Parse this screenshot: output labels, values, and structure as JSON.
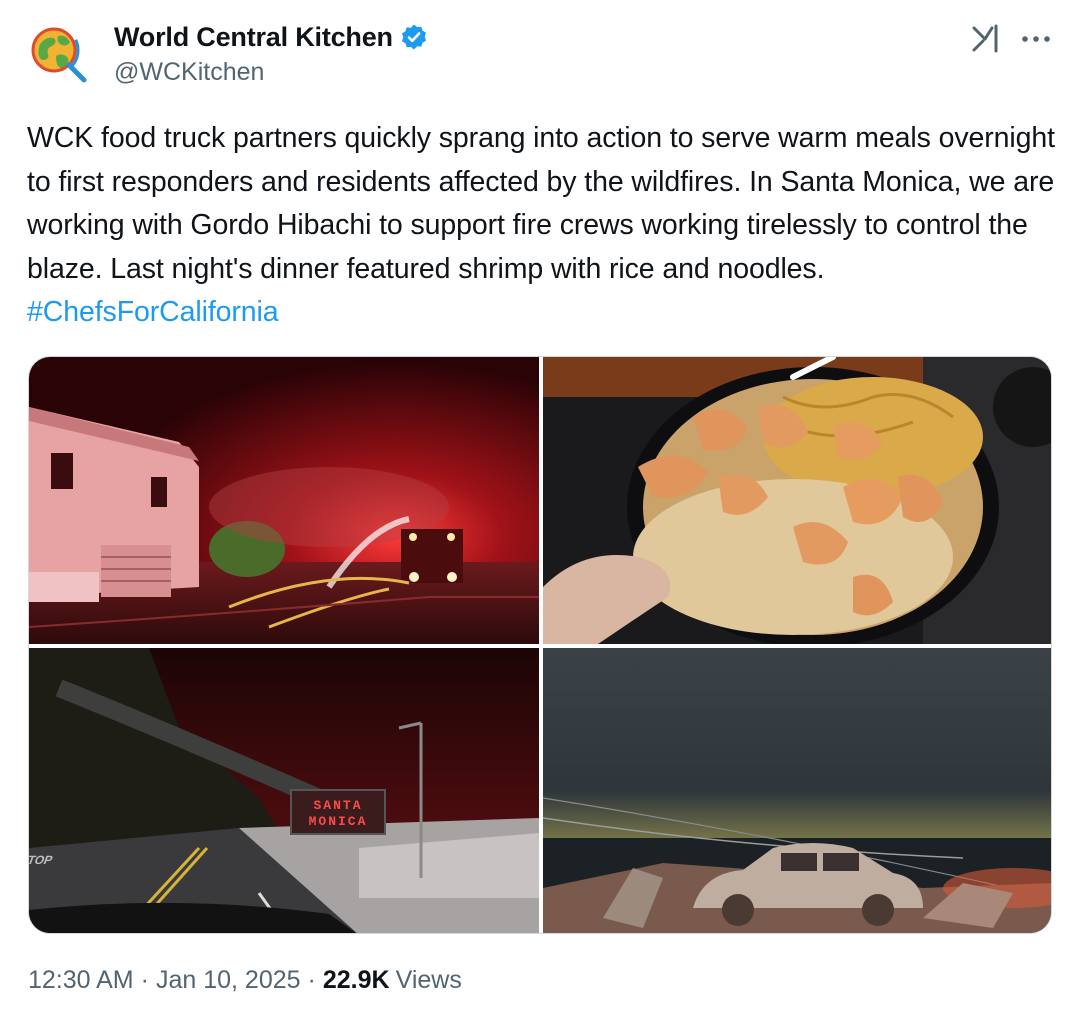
{
  "author": {
    "display_name": "World Central Kitchen",
    "handle": "@WCKitchen",
    "verified": true,
    "avatar_icon": "wck-globe-logo-icon"
  },
  "actions": {
    "grok_icon": "grok-icon",
    "more_icon": "more-dots-icon"
  },
  "tweet": {
    "text": "WCK food truck partners quickly sprang into action to serve warm meals overnight to first responders and residents affected by the wildfires. In Santa Monica, we are working with Gordo Hibachi to support fire crews working tirelessly to control the blaze. Last night's dinner featured shrimp with rice and noodles. ",
    "hashtag": "#ChefsForCalifornia"
  },
  "media": {
    "sign_line1": "SANTA",
    "sign_line2": "MONICA",
    "road_marking": "STOP"
  },
  "meta": {
    "time": "12:30 AM",
    "date": "Jan 10, 2025",
    "separator": "·",
    "views_count": "22.9K",
    "views_label": "Views"
  },
  "colors": {
    "link": "#1d9bf0",
    "secondary_text": "#536471",
    "primary_text": "#0f1419",
    "verified": "#1d9bf0"
  }
}
